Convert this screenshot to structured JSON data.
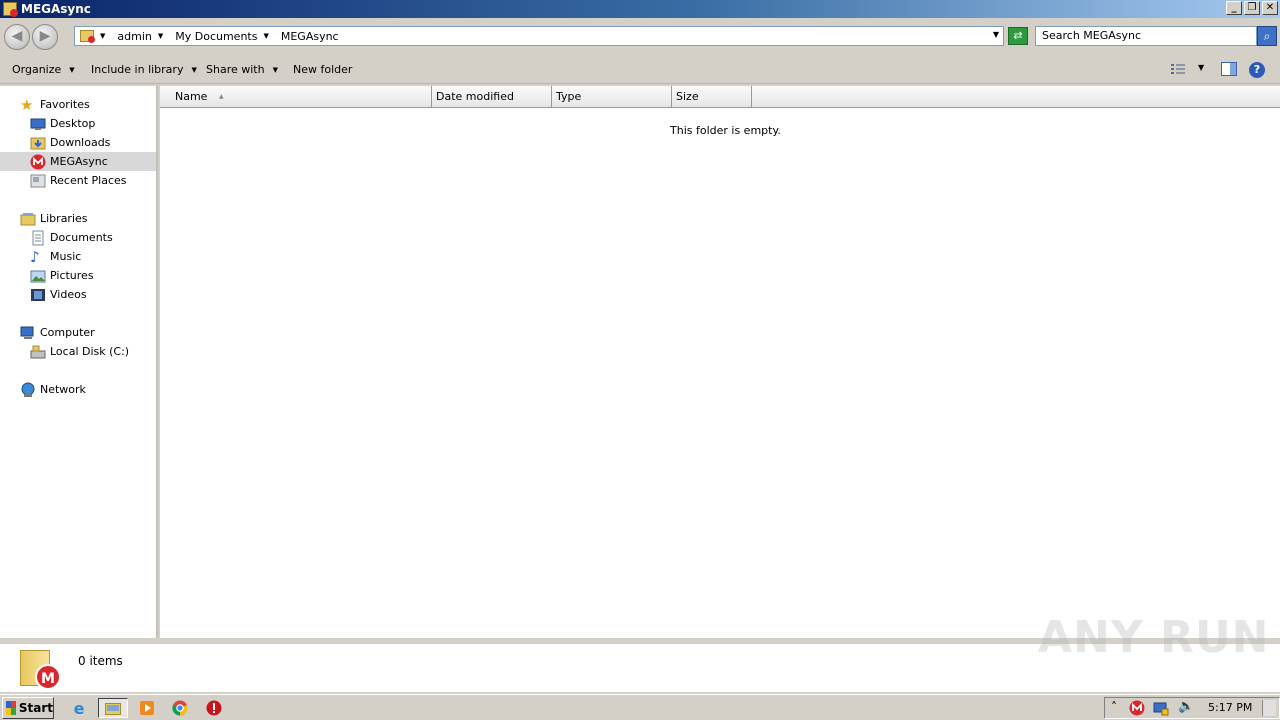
{
  "window": {
    "title": "MEGAsync",
    "controls": {
      "minimize": "_",
      "restore": "❐",
      "close": "✕"
    }
  },
  "address": {
    "breadcrumbs": [
      "admin",
      "My Documents",
      "MEGAsync"
    ],
    "search_placeholder": "Search MEGAsync"
  },
  "toolbar": {
    "organize": "Organize",
    "include_in_library": "Include in library",
    "share_with": "Share with",
    "new_folder": "New folder"
  },
  "nav": {
    "favorites": {
      "label": "Favorites",
      "items": [
        "Desktop",
        "Downloads",
        "MEGAsync",
        "Recent Places"
      ],
      "selected": "MEGAsync"
    },
    "libraries": {
      "label": "Libraries",
      "items": [
        "Documents",
        "Music",
        "Pictures",
        "Videos"
      ]
    },
    "computer": {
      "label": "Computer",
      "items": [
        "Local Disk (C:)"
      ]
    },
    "network": {
      "label": "Network"
    }
  },
  "content": {
    "columns": [
      "Name",
      "Date modified",
      "Type",
      "Size"
    ],
    "sort_indicator": "▲",
    "empty_message": "This folder is empty."
  },
  "details": {
    "item_count": "0 items",
    "mega_glyph": "M"
  },
  "watermark": "ANY RUN",
  "taskbar": {
    "start_label": "Start",
    "clock": "5:17 PM",
    "tray_up": "˄",
    "tray_mega_glyph": "M"
  },
  "colors": {
    "mega_red": "#d9272e",
    "title_start": "#0a246a",
    "title_end": "#a6caf0",
    "selection": "#d8d8d8"
  }
}
